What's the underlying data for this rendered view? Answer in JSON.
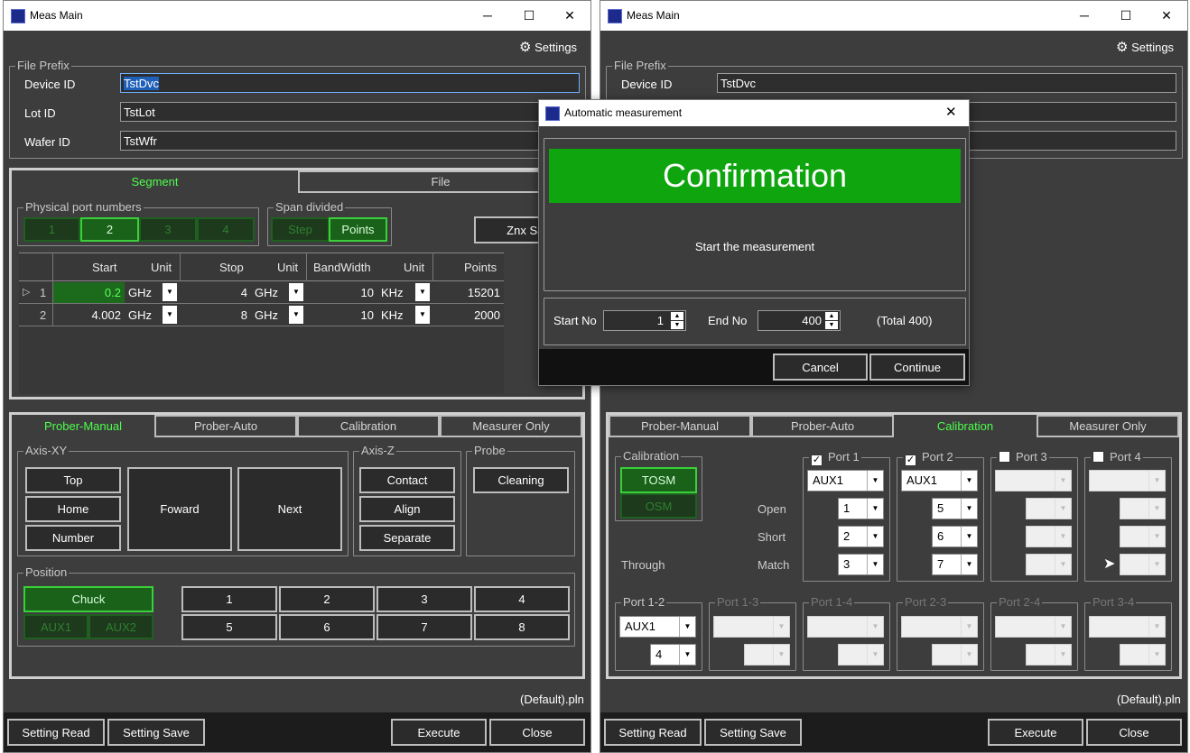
{
  "window": {
    "title": "Meas Main",
    "minimize": "─",
    "maximize": "☐",
    "close": "✕",
    "settings": "Settings",
    "settings_icon": "gear-icon"
  },
  "file_prefix": {
    "legend": "File Prefix",
    "device_label": "Device ID",
    "device_value": "TstDvc",
    "lot_label": "Lot ID",
    "lot_value": "TstLot",
    "wafer_label": "Wafer ID",
    "wafer_value": "TstWfr"
  },
  "tabs_top": {
    "segment": "Segment",
    "file": "File"
  },
  "ports": {
    "legend": "Physical port numbers",
    "items": [
      "1",
      "2",
      "3",
      "4"
    ]
  },
  "span": {
    "legend": "Span divided",
    "step": "Step",
    "points": "Points"
  },
  "znx_save": "Znx Sav",
  "grid": {
    "headers": {
      "start": "Start",
      "unit": "Unit",
      "stop": "Stop",
      "bandwidth": "BandWidth",
      "points": "Points"
    },
    "rows": [
      {
        "no": "1",
        "start": "0.2",
        "start_unit": "GHz",
        "stop": "4",
        "stop_unit": "GHz",
        "bw": "10",
        "bw_unit": "KHz",
        "points": "15201"
      },
      {
        "no": "2",
        "start": "4.002",
        "start_unit": "GHz",
        "stop": "8",
        "stop_unit": "GHz",
        "bw": "10",
        "bw_unit": "KHz",
        "points": "2000"
      }
    ]
  },
  "tabs_bottom": {
    "prober_manual": "Prober-Manual",
    "prober_auto": "Prober-Auto",
    "calibration": "Calibration",
    "measurer_only": "Measurer Only"
  },
  "axis_xy": {
    "legend": "Axis-XY",
    "top": "Top",
    "home": "Home",
    "number": "Number",
    "foward": "Foward",
    "next": "Next"
  },
  "axis_z": {
    "legend": "Axis-Z",
    "contact": "Contact",
    "align": "Align",
    "separate": "Separate"
  },
  "probe": {
    "legend": "Probe",
    "cleaning": "Cleaning"
  },
  "position": {
    "legend": "Position",
    "chuck": "Chuck",
    "aux1": "AUX1",
    "aux2": "AUX2",
    "numbers": [
      "1",
      "2",
      "3",
      "4",
      "5",
      "6",
      "7",
      "8"
    ]
  },
  "plan_file": "(Default).pln",
  "footer": {
    "setting_read": "Setting Read",
    "setting_save": "Setting Save",
    "execute": "Execute",
    "close": "Close"
  },
  "calibration": {
    "legend": "Calibration",
    "tosm": "TOSM",
    "osm": "OSM",
    "ports": [
      "Port 1",
      "Port 2",
      "Port 3",
      "Port 4"
    ],
    "rows": {
      "open": "Open",
      "short": "Short",
      "through": "Through",
      "match": "Match"
    },
    "port1": {
      "aux": "AUX1",
      "open": "1",
      "short": "2",
      "match": "3"
    },
    "port2": {
      "aux": "AUX1",
      "open": "5",
      "short": "6",
      "match": "7"
    },
    "pairs": [
      "Port 1-2",
      "Port 1-3",
      "Port 1-4",
      "Port 2-3",
      "Port 2-4",
      "Port 3-4"
    ],
    "pair12": {
      "aux": "AUX1",
      "value": "4"
    }
  },
  "dialog": {
    "title": "Automatic measurement",
    "close": "✕",
    "banner": "Confirmation",
    "message": "Start the measurement",
    "start_label": "Start No",
    "start_value": "1",
    "end_label": "End No",
    "end_value": "400",
    "total": "(Total 400)",
    "cancel": "Cancel",
    "continue": "Continue"
  }
}
